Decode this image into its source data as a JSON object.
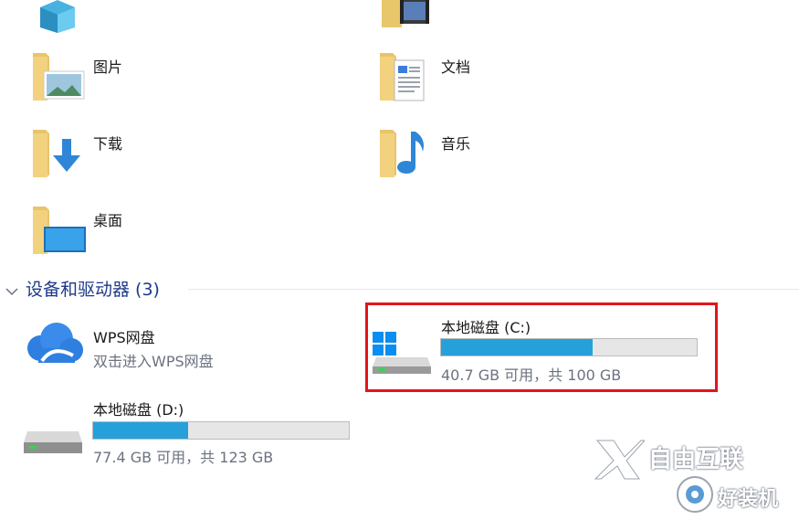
{
  "folders": [
    {
      "name": "图片",
      "icon": "pictures-folder-icon"
    },
    {
      "name": "文档",
      "icon": "documents-folder-icon"
    },
    {
      "name": "下载",
      "icon": "downloads-folder-icon"
    },
    {
      "name": "音乐",
      "icon": "music-folder-icon"
    },
    {
      "name": "桌面",
      "icon": "desktop-folder-icon"
    }
  ],
  "section": {
    "title": "设备和驱动器 (3)"
  },
  "wps": {
    "name": "WPS网盘",
    "subtitle": "双击进入WPS网盘",
    "icon": "cloud-icon"
  },
  "drive_c": {
    "name": "本地磁盘 (C:)",
    "usage_text": "40.7 GB 可用，共 100 GB",
    "used_fraction": 0.593,
    "icon": "windows-drive-icon"
  },
  "drive_d": {
    "name": "本地磁盘 (D:)",
    "usage_text": "77.4 GB 可用，共 123 GB",
    "used_fraction": 0.371,
    "icon": "drive-icon"
  },
  "colors": {
    "bar_fill": "#26a0da",
    "bar_bg": "#e6e6e6",
    "highlight": "#e3141b",
    "section_title": "#1e3a8a"
  },
  "watermark": {
    "brand": "自由互联",
    "sub": "好装机"
  }
}
